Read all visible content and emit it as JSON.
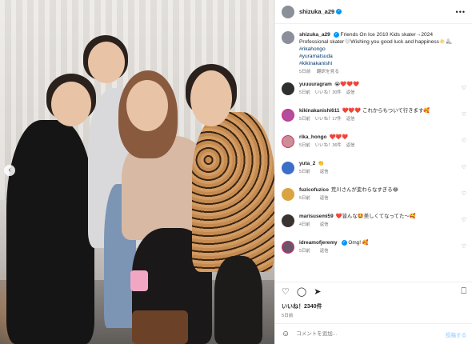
{
  "post": {
    "username": "shizuka_a29",
    "caption_text": "Friends On Ice 2010 Kids skater→2024 Professional skater🤍Wishing you good luck and happiness🌤️⛸️",
    "hashtags": [
      "#rikahongo",
      "#yuramatsuda",
      "#kikinakanishi"
    ],
    "caption_time": "5日前",
    "see_translation": "翻訳を見る",
    "likes": "いいね！2340件",
    "posted": "5日前",
    "add_comment_placeholder": "コメントを追加...",
    "post_button": "投稿する"
  },
  "comments": [
    {
      "user": "yuuuuragram",
      "text": "😭❤️❤️❤️",
      "time": "5日前",
      "likes": "いいね！30件",
      "reply": "返信"
    },
    {
      "user": "kikinakanishi611",
      "text": "❤️❤️❤️ これからもついて行きます🥰",
      "time": "5日前",
      "likes": "いいね！17件",
      "reply": "返信"
    },
    {
      "user": "rika_hongo",
      "text": "❤️❤️❤️",
      "time": "5日前",
      "likes": "いいね！36件",
      "reply": "返信"
    },
    {
      "user": "yuta_2",
      "text": "👏",
      "time": "5日前",
      "likes": "",
      "reply": "返信"
    },
    {
      "user": "fuzicofuzico",
      "text": "荒川さんが変わらなすぎる😂",
      "time": "5日前",
      "likes": "",
      "reply": "返信"
    },
    {
      "user": "marisusemi59",
      "text": "❤️皆んな🤩美しくてなってた〜🥰",
      "time": "4日前",
      "likes": "",
      "reply": "返信"
    },
    {
      "user": "idreamofjeremy",
      "text": "Omg! 🥰",
      "time": "5日前",
      "likes": "",
      "reply": "返信"
    }
  ],
  "colors": {
    "link": "#00376b",
    "verified": "#0095f6",
    "muted": "#737373"
  }
}
